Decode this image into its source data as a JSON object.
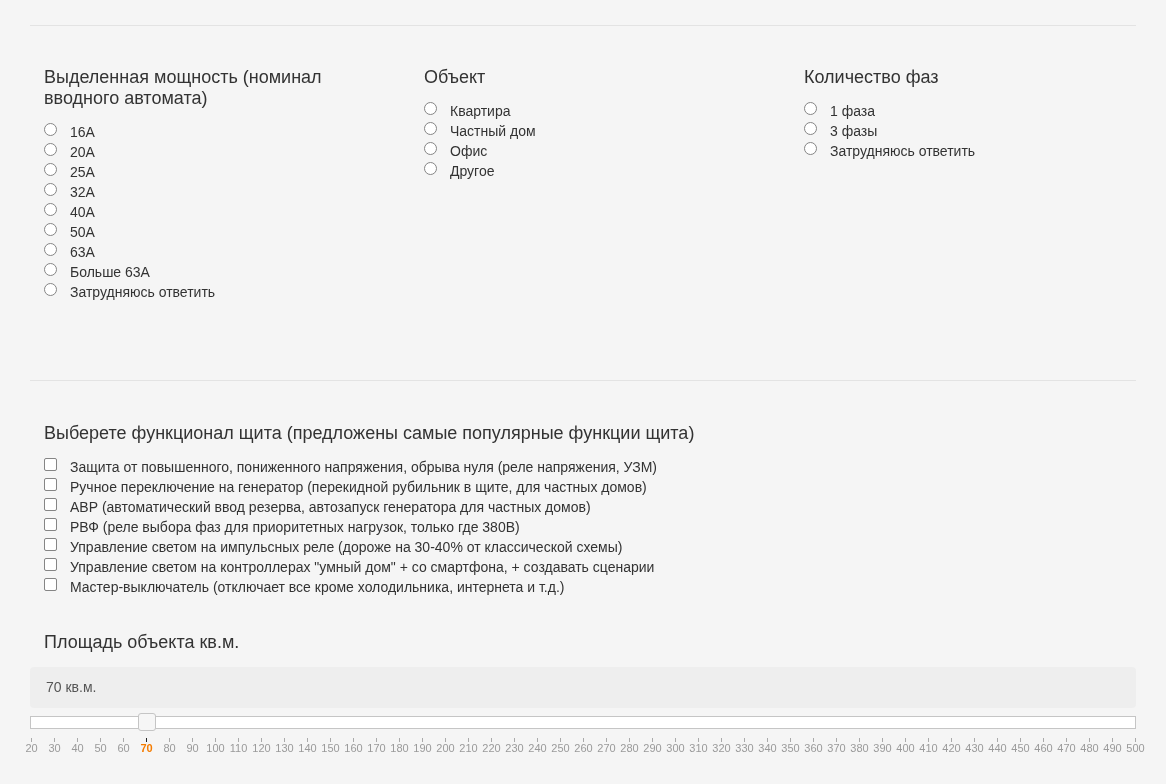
{
  "radio_groups": [
    {
      "title": "Выделенная мощность (номинал вводного автомата)",
      "options": [
        {
          "label": "16А",
          "selected": false
        },
        {
          "label": "20А",
          "selected": false
        },
        {
          "label": "25А",
          "selected": false
        },
        {
          "label": "32А",
          "selected": false
        },
        {
          "label": "40А",
          "selected": false
        },
        {
          "label": "50А",
          "selected": false
        },
        {
          "label": "63А",
          "selected": false
        },
        {
          "label": "Больше 63А",
          "selected": false
        },
        {
          "label": "Затрудняюсь ответить",
          "selected": false
        }
      ]
    },
    {
      "title": "Объект",
      "options": [
        {
          "label": "Квартира",
          "selected": false
        },
        {
          "label": "Частный дом",
          "selected": false
        },
        {
          "label": "Офис",
          "selected": false
        },
        {
          "label": "Другое",
          "selected": false
        }
      ]
    },
    {
      "title": "Количество фаз",
      "options": [
        {
          "label": "1 фаза",
          "selected": false
        },
        {
          "label": "3 фазы",
          "selected": false
        },
        {
          "label": "Затрудняюсь ответить",
          "selected": false
        }
      ]
    }
  ],
  "functions": {
    "title": "Выберете функционал щита (предложены самые популярные функции щита)",
    "options": [
      {
        "label": "Защита от повышенного, пониженного напряжения, обрыва нуля (реле напряжения, УЗМ)",
        "checked": false
      },
      {
        "label": "Ручное переключение на генератор (перекидной рубильник в щите, для частных домов)",
        "checked": false
      },
      {
        "label": "АВР (автоматический ввод резерва, автозапуск генератора для частных домов)",
        "checked": false
      },
      {
        "label": "РВФ (реле выбора фаз для приоритетных нагрузок, только где 380В)",
        "checked": false
      },
      {
        "label": "Управление светом на импульсных реле (дороже на 30-40% от классической схемы)",
        "checked": false
      },
      {
        "label": "Управление светом на контроллерах \"умный дом\" + со смартфона, + создавать сценарии",
        "checked": false
      },
      {
        "label": "Мастер-выключатель (отключает все кроме холодильника, интернета и т.д.)",
        "checked": false
      }
    ]
  },
  "area": {
    "title": "Площадь объекта кв.м.",
    "value_text": "70 кв.м.",
    "slider": {
      "level": 0.104
    },
    "scale": [
      {
        "label": "20",
        "selected": false
      },
      {
        "label": "30",
        "selected": false
      },
      {
        "label": "40",
        "selected": false
      },
      {
        "label": "50",
        "selected": false
      },
      {
        "label": "60",
        "selected": false
      },
      {
        "label": "70",
        "selected": true
      },
      {
        "label": "80",
        "selected": false
      },
      {
        "label": "90",
        "selected": false
      },
      {
        "label": "100",
        "selected": false
      },
      {
        "label": "110",
        "selected": false
      },
      {
        "label": "120",
        "selected": false
      },
      {
        "label": "130",
        "selected": false
      },
      {
        "label": "140",
        "selected": false
      },
      {
        "label": "150",
        "selected": false
      },
      {
        "label": "160",
        "selected": false
      },
      {
        "label": "170",
        "selected": false
      },
      {
        "label": "180",
        "selected": false
      },
      {
        "label": "190",
        "selected": false
      },
      {
        "label": "200",
        "selected": false
      },
      {
        "label": "210",
        "selected": false
      },
      {
        "label": "220",
        "selected": false
      },
      {
        "label": "230",
        "selected": false
      },
      {
        "label": "240",
        "selected": false
      },
      {
        "label": "250",
        "selected": false
      },
      {
        "label": "260",
        "selected": false
      },
      {
        "label": "270",
        "selected": false
      },
      {
        "label": "280",
        "selected": false
      },
      {
        "label": "290",
        "selected": false
      },
      {
        "label": "300",
        "selected": false
      },
      {
        "label": "310",
        "selected": false
      },
      {
        "label": "320",
        "selected": false
      },
      {
        "label": "330",
        "selected": false
      },
      {
        "label": "340",
        "selected": false
      },
      {
        "label": "350",
        "selected": false
      },
      {
        "label": "360",
        "selected": false
      },
      {
        "label": "370",
        "selected": false
      },
      {
        "label": "380",
        "selected": false
      },
      {
        "label": "390",
        "selected": false
      },
      {
        "label": "400",
        "selected": false
      },
      {
        "label": "410",
        "selected": false
      },
      {
        "label": "420",
        "selected": false
      },
      {
        "label": "430",
        "selected": false
      },
      {
        "label": "440",
        "selected": false
      },
      {
        "label": "450",
        "selected": false
      },
      {
        "label": "460",
        "selected": false
      },
      {
        "label": "470",
        "selected": false
      },
      {
        "label": "480",
        "selected": false
      },
      {
        "label": "490",
        "selected": false
      },
      {
        "label": "500",
        "selected": false
      }
    ]
  }
}
